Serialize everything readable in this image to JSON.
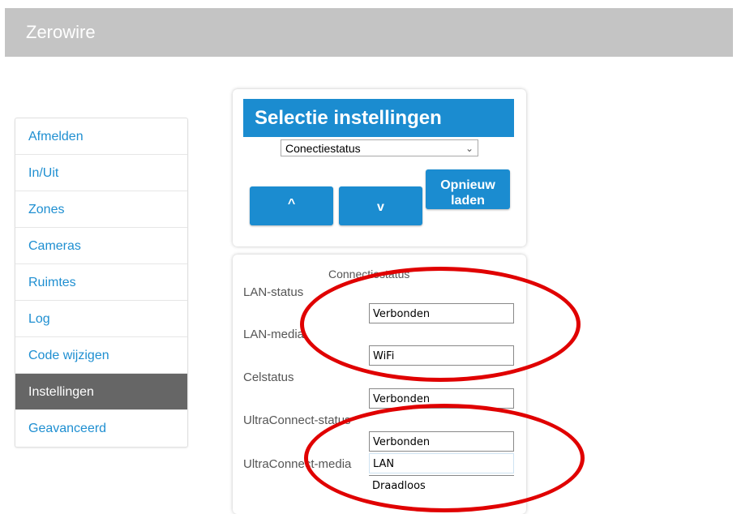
{
  "app": {
    "title": "Zerowire"
  },
  "sidebar": {
    "items": [
      {
        "label": "Afmelden"
      },
      {
        "label": "In/Uit"
      },
      {
        "label": "Zones"
      },
      {
        "label": "Cameras"
      },
      {
        "label": "Ruimtes"
      },
      {
        "label": "Log"
      },
      {
        "label": "Code wijzigen"
      },
      {
        "label": "Instellingen",
        "active": true
      },
      {
        "label": "Geavanceerd"
      }
    ]
  },
  "settings_panel": {
    "header": "Selectie instellingen",
    "selected_option": "Conectiestatus",
    "up_label": "^",
    "down_label": "v",
    "reload_label": "Opnieuw laden"
  },
  "status_panel": {
    "title": "Connectiestatus",
    "fields": [
      {
        "label": "LAN-status",
        "value": "Verbonden"
      },
      {
        "label": "LAN-media",
        "value": "WiFi"
      },
      {
        "label": "Celstatus",
        "value": "Verbonden"
      },
      {
        "label": "UltraConnect-status",
        "value": "Verbonden"
      },
      {
        "label": "UltraConnect-media",
        "value": "LAN",
        "value2": "Draadloos"
      }
    ]
  },
  "colors": {
    "accent": "#1b8cd0",
    "active_item": "#666666",
    "topbar": "#c4c4c4",
    "annotation": "#e00000"
  },
  "icons": {
    "select_chevron": "chevron-down-icon"
  }
}
